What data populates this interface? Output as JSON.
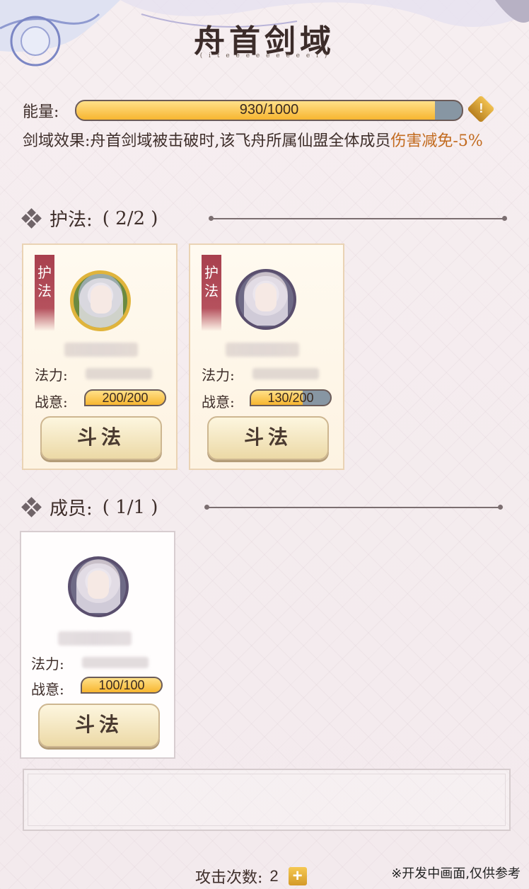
{
  "header": {
    "title": "舟首剑域",
    "subtitle": "( i t e e e e e e e e e i )"
  },
  "energy": {
    "label": "能量:",
    "current": 930,
    "max": 1000,
    "text": "930/1000",
    "icon": "warning-diamond-icon"
  },
  "effect": {
    "prefix": "剑域效果:舟首剑域被击破时,该飞舟所属仙盟全体成员",
    "highlight": "伤害减免-5%"
  },
  "sections": {
    "guardians": {
      "label": "护法:",
      "count": "( 2/2 )"
    },
    "members": {
      "label": "成员:",
      "count": "( 1/1 )"
    }
  },
  "guardians": [
    {
      "tag": "护法",
      "fali_label": "法力:",
      "zhanyi_label": "战意:",
      "zhanyi_text": "200/200",
      "zhanyi_fraction": 1.0,
      "button": "斗法"
    },
    {
      "tag": "护法",
      "fali_label": "法力:",
      "zhanyi_label": "战意:",
      "zhanyi_text": "130/200",
      "zhanyi_fraction": 0.65,
      "button": "斗法"
    }
  ],
  "members": [
    {
      "fali_label": "法力:",
      "zhanyi_label": "战意:",
      "zhanyi_text": "100/100",
      "zhanyi_fraction": 1.0,
      "button": "斗法"
    }
  ],
  "footer": {
    "attack_label": "攻击次数:",
    "attack_count": "2",
    "plus": "+",
    "disclaimer": "※开发中画面,仅供参考"
  },
  "colors": {
    "highlight": "#c26a1e",
    "bar_fill": "#f7b630",
    "bar_empty": "#8796a3"
  }
}
